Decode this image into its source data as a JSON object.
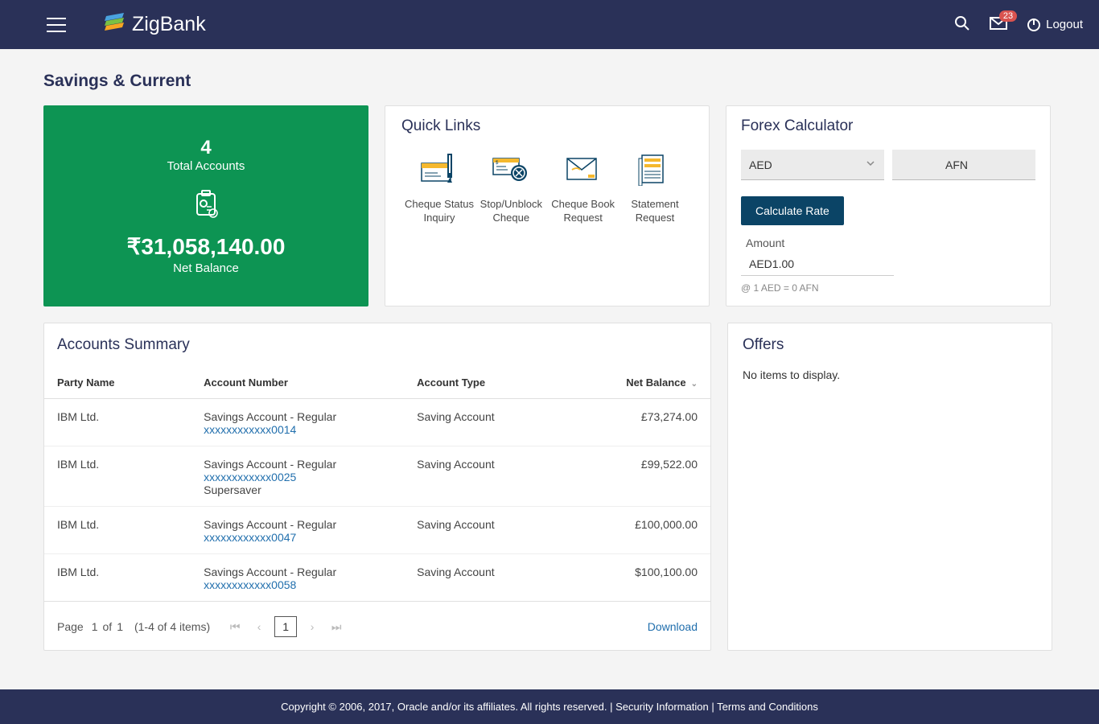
{
  "header": {
    "brand": "ZigBank",
    "notif_count": "23",
    "logout": "Logout"
  },
  "page_title": "Savings & Current",
  "summary": {
    "count": "4",
    "count_label": "Total Accounts",
    "balance": "₹31,058,140.00",
    "balance_label": "Net Balance"
  },
  "quick_links": {
    "title": "Quick Links",
    "items": [
      {
        "label": "Cheque Status Inquiry"
      },
      {
        "label": "Stop/Unblock Cheque"
      },
      {
        "label": "Cheque Book Request"
      },
      {
        "label": "Statement Request"
      }
    ]
  },
  "forex": {
    "title": "Forex Calculator",
    "from": "AED",
    "to": "AFN",
    "button": "Calculate Rate",
    "amount_label": "Amount",
    "amount_value": "AED1.00",
    "rate_text": "@ 1 AED = 0 AFN"
  },
  "accounts": {
    "title": "Accounts Summary",
    "headers": {
      "party": "Party Name",
      "number": "Account Number",
      "type": "Account Type",
      "balance": "Net Balance"
    },
    "rows": [
      {
        "party": "IBM Ltd.",
        "desc": "Savings Account - Regular",
        "number": "xxxxxxxxxxxx0014",
        "extra": "",
        "type": "Saving Account",
        "balance": "£73,274.00"
      },
      {
        "party": "IBM Ltd.",
        "desc": "Savings Account - Regular",
        "number": "xxxxxxxxxxxx0025",
        "extra": "Supersaver",
        "type": "Saving Account",
        "balance": "£99,522.00"
      },
      {
        "party": "IBM Ltd.",
        "desc": "Savings Account - Regular",
        "number": "xxxxxxxxxxxx0047",
        "extra": "",
        "type": "Saving Account",
        "balance": "£100,000.00"
      },
      {
        "party": "IBM Ltd.",
        "desc": "Savings Account - Regular",
        "number": "xxxxxxxxxxxx0058",
        "extra": "",
        "type": "Saving Account",
        "balance": "$100,100.00"
      }
    ],
    "pager": {
      "page_label": "Page",
      "current": "1",
      "of": "of",
      "total": "1",
      "range": "(1-4 of 4 items)",
      "download": "Download"
    }
  },
  "offers": {
    "title": "Offers",
    "empty": "No items to display."
  },
  "footer": {
    "copyright": "Copyright © 2006, 2017, Oracle and/or its affiliates. All rights reserved. | ",
    "security": "Security Information",
    "sep": " | ",
    "terms": "Terms and Conditions"
  }
}
